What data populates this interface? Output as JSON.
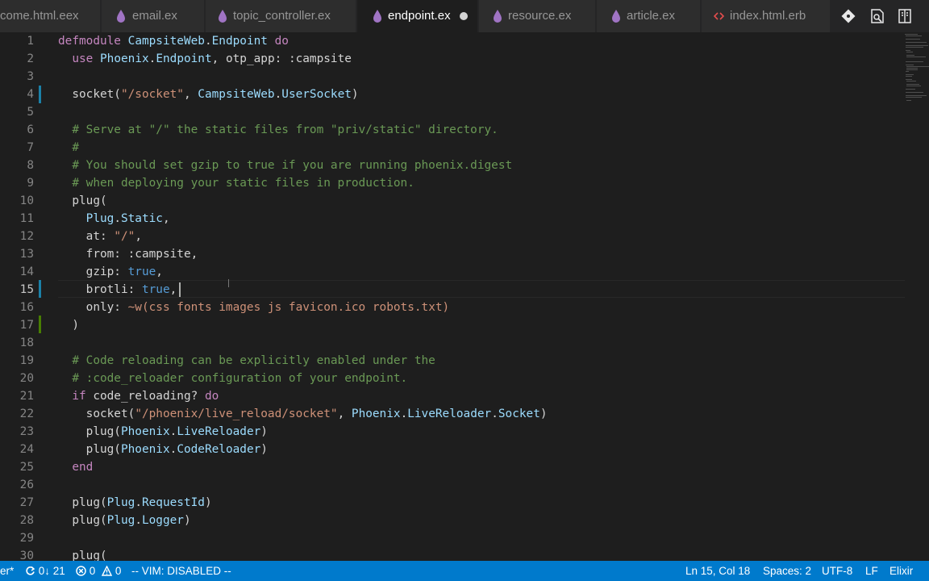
{
  "tabs": [
    {
      "label": "come.html.eex",
      "icon": "eex-file-icon",
      "active": false
    },
    {
      "label": "email.ex",
      "icon": "elixir-drop-icon",
      "active": false
    },
    {
      "label": "topic_controller.ex",
      "icon": "elixir-drop-icon",
      "active": false
    },
    {
      "label": "endpoint.ex",
      "icon": "elixir-drop-icon",
      "active": true,
      "dirty": true
    },
    {
      "label": "resource.ex",
      "icon": "elixir-drop-icon",
      "active": false
    },
    {
      "label": "article.ex",
      "icon": "elixir-drop-icon",
      "active": false
    },
    {
      "label": "index.html.erb",
      "icon": "erb-code-icon",
      "active": false
    }
  ],
  "tab_actions": [
    "git-compare-icon",
    "open-preview-icon",
    "split-editor-icon"
  ],
  "editor": {
    "current_line": 15,
    "lines": [
      {
        "n": "1",
        "text": "defmodule CampsiteWeb.Endpoint do"
      },
      {
        "n": "2",
        "text": "  use Phoenix.Endpoint, otp_app: :campsite"
      },
      {
        "n": "3",
        "text": ""
      },
      {
        "n": "4",
        "text": "  socket(\"/socket\", CampsiteWeb.UserSocket)"
      },
      {
        "n": "5",
        "text": ""
      },
      {
        "n": "6",
        "text": "  # Serve at \"/\" the static files from \"priv/static\" directory."
      },
      {
        "n": "7",
        "text": "  #"
      },
      {
        "n": "8",
        "text": "  # You should set gzip to true if you are running phoenix.digest"
      },
      {
        "n": "9",
        "text": "  # when deploying your static files in production."
      },
      {
        "n": "10",
        "text": "  plug("
      },
      {
        "n": "11",
        "text": "    Plug.Static,"
      },
      {
        "n": "12",
        "text": "    at: \"/\","
      },
      {
        "n": "13",
        "text": "    from: :campsite,"
      },
      {
        "n": "14",
        "text": "    gzip: true,"
      },
      {
        "n": "15",
        "text": "    brotli: true,"
      },
      {
        "n": "16",
        "text": "    only: ~w(css fonts images js favicon.ico robots.txt)"
      },
      {
        "n": "17",
        "text": "  )"
      },
      {
        "n": "18",
        "text": ""
      },
      {
        "n": "19",
        "text": "  # Code reloading can be explicitly enabled under the"
      },
      {
        "n": "20",
        "text": "  # :code_reloader configuration of your endpoint."
      },
      {
        "n": "21",
        "text": "  if code_reloading? do"
      },
      {
        "n": "22",
        "text": "    socket(\"/phoenix/live_reload/socket\", Phoenix.LiveReloader.Socket)"
      },
      {
        "n": "23",
        "text": "    plug(Phoenix.LiveReloader)"
      },
      {
        "n": "24",
        "text": "    plug(Phoenix.CodeReloader)"
      },
      {
        "n": "25",
        "text": "  end"
      },
      {
        "n": "26",
        "text": ""
      },
      {
        "n": "27",
        "text": "  plug(Plug.RequestId)"
      },
      {
        "n": "28",
        "text": "  plug(Plug.Logger)"
      },
      {
        "n": "29",
        "text": ""
      },
      {
        "n": "30",
        "text": "  plug("
      }
    ]
  },
  "status": {
    "branch": "er*",
    "sync": "0↓ 21",
    "errors": "0",
    "warnings": "0",
    "vim": "-- VIM: DISABLED --",
    "position": "Ln 15, Col 18",
    "spaces": "Spaces: 2",
    "encoding": "UTF-8",
    "eol": "LF",
    "language": "Elixir"
  },
  "colors": {
    "statusbar": "#007acc",
    "editor_bg": "#1e1e1e",
    "tab_inactive_bg": "#2d2d2d",
    "elixir_icon": "#a074c4",
    "gutter_modified": "#1b81a8",
    "gutter_added": "#487e02"
  }
}
